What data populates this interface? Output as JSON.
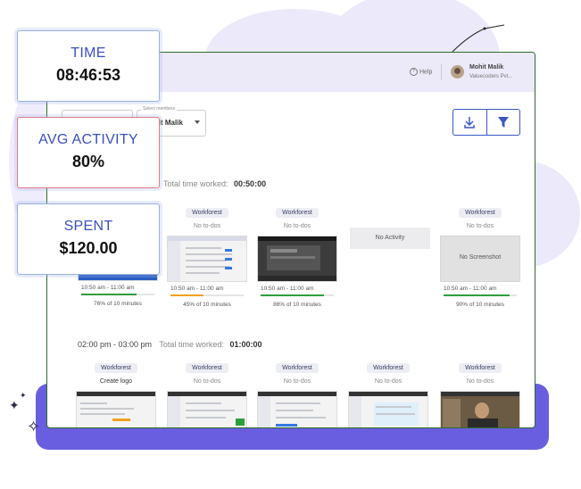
{
  "header": {
    "help_label": "Help",
    "user_name": "Mohit Malik",
    "user_org": "Valuecoders Pvt..."
  },
  "filters": {
    "member_label": "Select members",
    "member_value": "ohit Malik"
  },
  "stats": [
    {
      "title": "TIME",
      "value": "08:46:53"
    },
    {
      "title": "AVG ACTIVITY",
      "value": "80%"
    },
    {
      "title": "SPENT",
      "value": "$120.00"
    }
  ],
  "slot1": {
    "total_label": "Total time worked:",
    "total_value": "00:50:00"
  },
  "slot2": {
    "range": "02:00 pm - 03:00 pm",
    "total_label": "Total time worked:",
    "total_value": "01:00:00"
  },
  "row1": [
    {
      "project": "",
      "todo": "",
      "time": "10:50 am - 11:00 am",
      "pct": "76% of 10 minutes",
      "progress": 0.76,
      "color": "#2e9e3c"
    },
    {
      "project": "Workforest",
      "todo": "No to-dos",
      "time": "10:50 am - 11:00 am",
      "pct": "45% of 10 minutes",
      "progress": 0.45,
      "color": "#f0a020"
    },
    {
      "project": "Workforest",
      "todo": "No to-dos",
      "time": "10:50 am - 11:00 am",
      "pct": "86% of 10 minutes",
      "progress": 0.86,
      "color": "#2e9e3c"
    },
    {
      "project": "",
      "todo": "",
      "no_activity": "No Activity"
    },
    {
      "project": "Workforest",
      "todo": "No to-dos",
      "no_screenshot": "No Screenshot",
      "time": "10:50 am - 11:00 am",
      "pct": "90% of 10 minutes",
      "progress": 0.9,
      "color": "#2e9e3c"
    }
  ],
  "row2": [
    {
      "project": "Workforest",
      "todo": "Create logo"
    },
    {
      "project": "Workforest",
      "todo": "No to-dos"
    },
    {
      "project": "Workforest",
      "todo": "No to-dos"
    },
    {
      "project": "Workforest",
      "todo": "No to-dos"
    },
    {
      "project": "Workforest",
      "todo": "No to-dos"
    }
  ]
}
